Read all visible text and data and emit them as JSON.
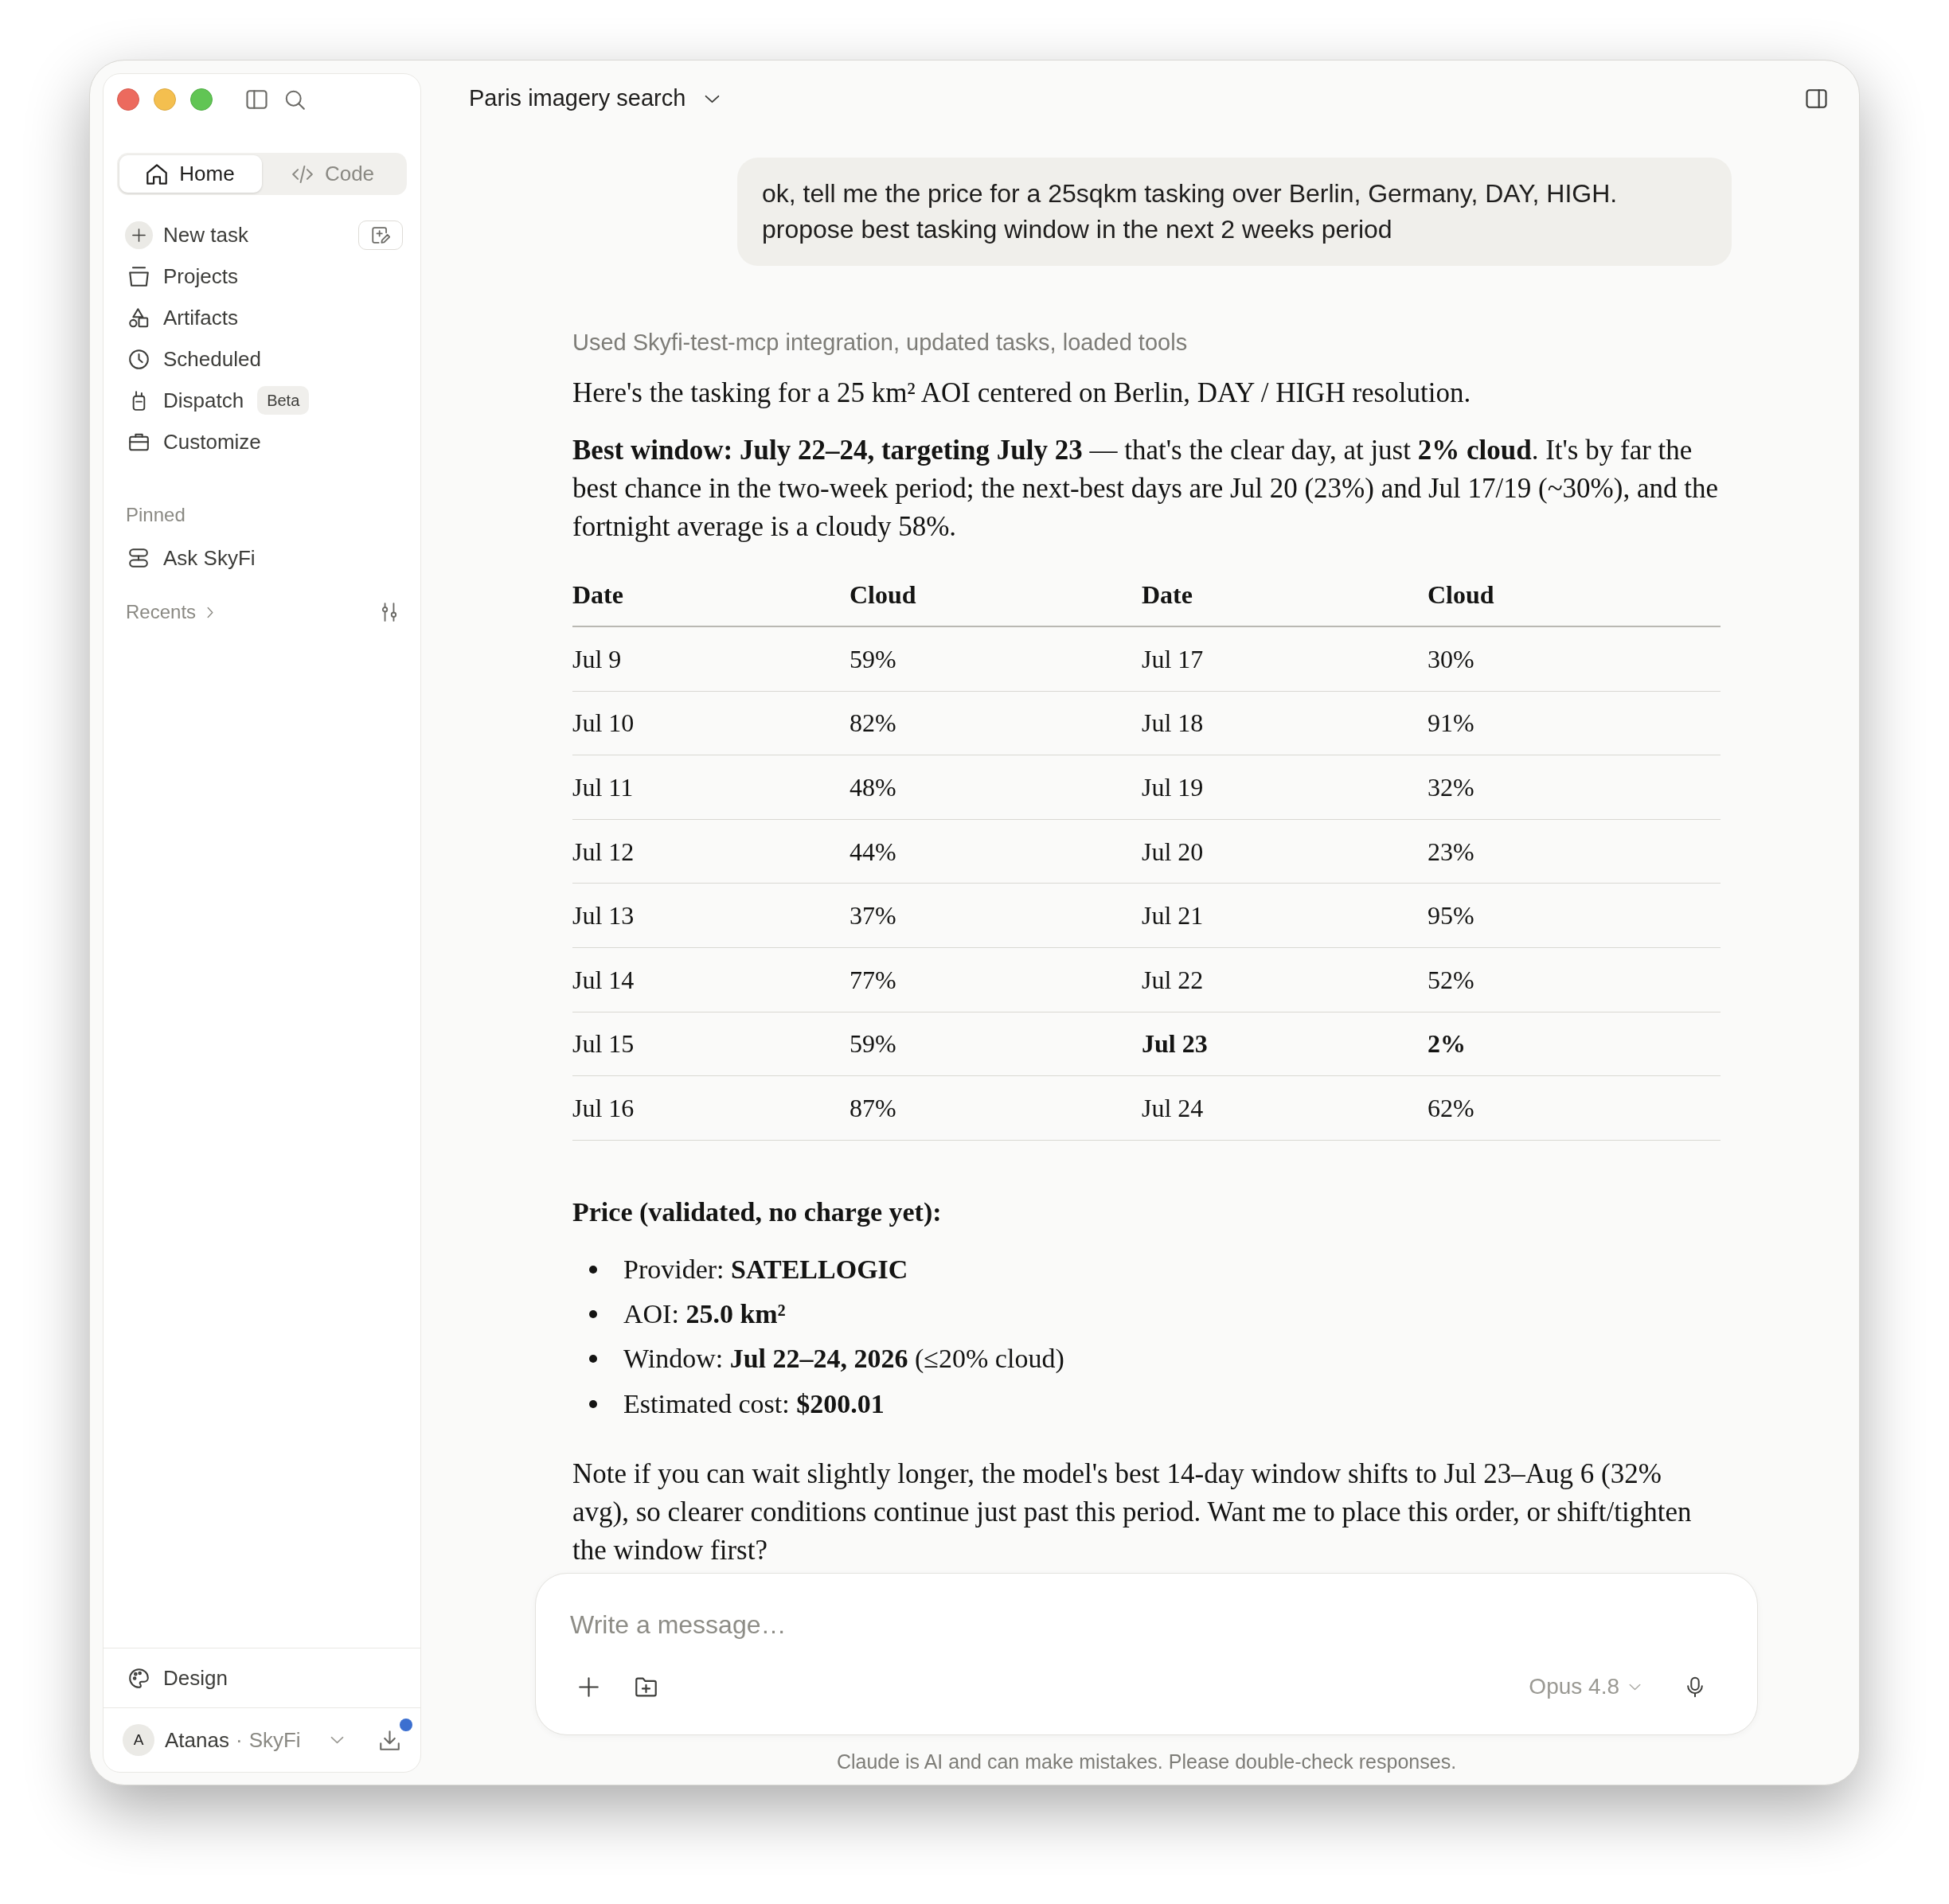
{
  "window": {
    "title": "Paris imagery search"
  },
  "sidebar": {
    "mode_tabs": [
      {
        "label": "Home",
        "selected": true
      },
      {
        "label": "Code",
        "selected": false
      }
    ],
    "nav_items": [
      {
        "label": "New task",
        "kind": "new_task"
      },
      {
        "label": "Projects",
        "kind": "link"
      },
      {
        "label": "Artifacts",
        "kind": "link"
      },
      {
        "label": "Scheduled",
        "kind": "link"
      },
      {
        "label": "Dispatch",
        "kind": "link",
        "badge": "Beta"
      },
      {
        "label": "Customize",
        "kind": "link"
      }
    ],
    "pinned": {
      "heading": "Pinned",
      "items": [
        {
          "label": "Ask SkyFi"
        }
      ]
    },
    "recents": {
      "heading": "Recents"
    },
    "footer_items": [
      {
        "label": "Design"
      }
    ],
    "account": {
      "initial": "A",
      "name": "Atanas",
      "separator": "·",
      "workspace": "SkyFi",
      "notification": true
    }
  },
  "conversation": {
    "user_message": "ok, tell me the price for a 25sqkm tasking over Berlin, Germany, DAY, HIGH.\npropose best tasking window in the next 2 weeks period",
    "tool_summary": "Used Skyfi-test-mcp integration, updated tasks, loaded tools",
    "paragraphs": [
      "Here's the tasking for a 25 km² AOI centered on Berlin, DAY / HIGH resolution.",
      "**Best window: July 22–24, targeting July 23** — that's the clear day, at just **2% cloud**. It's by far the best chance in the two-week period; the next-best days are Jul 20 (23%) and Jul 17/19 (~30%), and the fortnight average is a cloudy 58%."
    ],
    "table": {
      "columns": [
        "Date",
        "Cloud",
        "Date",
        "Cloud"
      ],
      "rows": [
        [
          {
            "text": "Jul 9",
            "bold": false
          },
          {
            "text": "59%",
            "bold": false
          },
          {
            "text": "Jul 17",
            "bold": false
          },
          {
            "text": "30%",
            "bold": false
          }
        ],
        [
          {
            "text": "Jul 10",
            "bold": false
          },
          {
            "text": "82%",
            "bold": false
          },
          {
            "text": "Jul 18",
            "bold": false
          },
          {
            "text": "91%",
            "bold": false
          }
        ],
        [
          {
            "text": "Jul 11",
            "bold": false
          },
          {
            "text": "48%",
            "bold": false
          },
          {
            "text": "Jul 19",
            "bold": false
          },
          {
            "text": "32%",
            "bold": false
          }
        ],
        [
          {
            "text": "Jul 12",
            "bold": false
          },
          {
            "text": "44%",
            "bold": false
          },
          {
            "text": "Jul 20",
            "bold": false
          },
          {
            "text": "23%",
            "bold": false
          }
        ],
        [
          {
            "text": "Jul 13",
            "bold": false
          },
          {
            "text": "37%",
            "bold": false
          },
          {
            "text": "Jul 21",
            "bold": false
          },
          {
            "text": "95%",
            "bold": false
          }
        ],
        [
          {
            "text": "Jul 14",
            "bold": false
          },
          {
            "text": "77%",
            "bold": false
          },
          {
            "text": "Jul 22",
            "bold": false
          },
          {
            "text": "52%",
            "bold": false
          }
        ],
        [
          {
            "text": "Jul 15",
            "bold": false
          },
          {
            "text": "59%",
            "bold": false
          },
          {
            "text": "Jul 23",
            "bold": true
          },
          {
            "text": "2%",
            "bold": true
          }
        ],
        [
          {
            "text": "Jul 16",
            "bold": false
          },
          {
            "text": "87%",
            "bold": false
          },
          {
            "text": "Jul 24",
            "bold": false
          },
          {
            "text": "62%",
            "bold": false
          }
        ]
      ]
    },
    "price": {
      "heading": "Price (validated, no charge yet):",
      "items": [
        "Provider: **SATELLOGIC**",
        "AOI: **25.0 km²**",
        "Window: **Jul 22–24, 2026** (≤20% cloud)",
        "Estimated cost: **$200.01**"
      ]
    },
    "note": "Note if you can wait slightly longer, the model's best 14-day window shifts to Jul 23–Aug 6 (32% avg), so clearer conditions continue just past this period. Want me to place this order, or shift/tighten the window first?"
  },
  "composer": {
    "placeholder": "Write a message…",
    "model": "Opus 4.8"
  },
  "disclaimer": "Claude is AI and can make mistakes. Please double-check responses."
}
